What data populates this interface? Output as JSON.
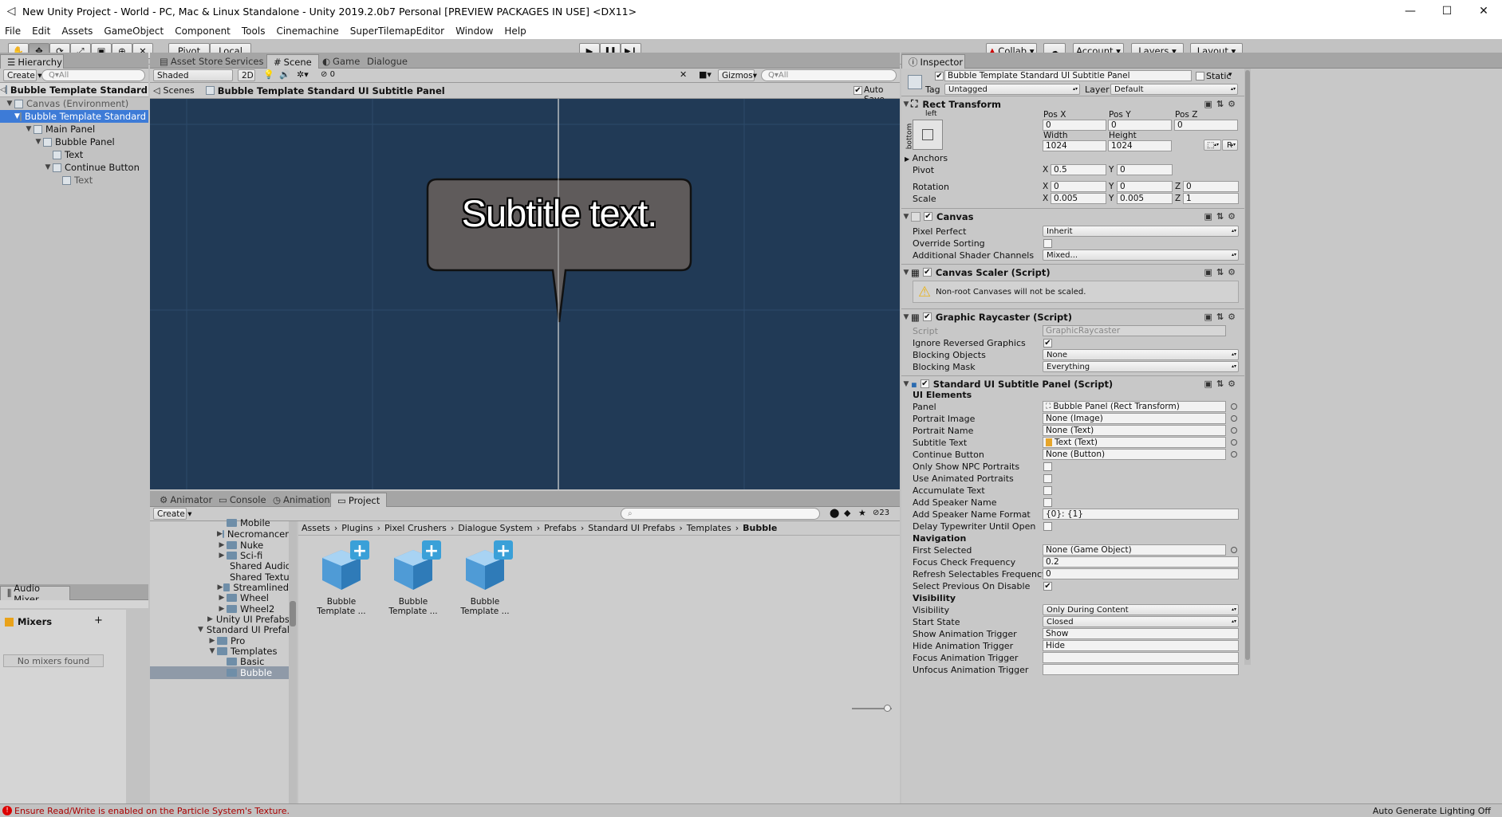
{
  "window": {
    "title": "New Unity Project - World - PC, Mac & Linux Standalone - Unity 2019.2.0b7 Personal [PREVIEW PACKAGES IN USE] <DX11>",
    "minimize": "—",
    "maximize": "☐",
    "close": "✕"
  },
  "menu": [
    "File",
    "Edit",
    "Assets",
    "GameObject",
    "Component",
    "Tools",
    "Cinemachine",
    "SuperTilemapEditor",
    "Window",
    "Help"
  ],
  "toolbar": {
    "pivot": "Pivot",
    "local": "Local",
    "collab": "Collab",
    "account": "Account",
    "layers": "Layers",
    "layout": "Layout",
    "play": "▶",
    "pause": "❚❚",
    "step": "▶❙"
  },
  "hierarchy": {
    "tab": "Hierarchy",
    "create": "Create",
    "search_placeholder": "Q▾All",
    "scene_title": "Bubble Template Standard UI",
    "items": [
      {
        "label": "Canvas (Environment)"
      },
      {
        "label": "Bubble Template Standard U"
      },
      {
        "label": "Main Panel"
      },
      {
        "label": "Bubble Panel"
      },
      {
        "label": "Text"
      },
      {
        "label": "Continue Button"
      },
      {
        "label": "Text"
      }
    ]
  },
  "audio_mixer": {
    "tab": "Audio Mixer",
    "mixers_label": "Mixers",
    "add": "+",
    "empty": "No mixers found"
  },
  "scene": {
    "tabs": [
      "Asset Store",
      "Services",
      "Scene",
      "Game",
      "Dialogue"
    ],
    "shading": "Shaded",
    "mode_2d": "2D",
    "fx_count": "0",
    "gizmos": "Gizmos",
    "search_placeholder": "Q▾All",
    "breadcrumb_root": "Scenes",
    "breadcrumb_item": "Bubble Template Standard UI Subtitle Panel",
    "auto_save": "Auto Save",
    "bubble_text": "Subtitle text.",
    "colors": {
      "bg": "#213a56",
      "bubble": "#5f5b5b"
    }
  },
  "project": {
    "tabs": [
      "Animator",
      "Console",
      "Animation",
      "Project"
    ],
    "create": "Create",
    "hidden_count": "23",
    "folders": [
      {
        "label": "Mobile"
      },
      {
        "label": "Necromancer"
      },
      {
        "label": "Nuke"
      },
      {
        "label": "Sci-fi"
      },
      {
        "label": "Shared Audio"
      },
      {
        "label": "Shared Textu"
      },
      {
        "label": "Streamlined"
      },
      {
        "label": "Wheel"
      },
      {
        "label": "Wheel2"
      },
      {
        "label": "Unity UI Prefabs"
      },
      {
        "label": "Standard UI Prefal"
      },
      {
        "label": "Pro"
      },
      {
        "label": "Templates"
      },
      {
        "label": "Basic"
      },
      {
        "label": "Bubble"
      }
    ],
    "breadcrumb": [
      "Assets",
      "Plugins",
      "Pixel Crushers",
      "Dialogue System",
      "Prefabs",
      "Standard UI Prefabs",
      "Templates",
      "Bubble"
    ],
    "assets": [
      {
        "label": "Bubble Template ..."
      },
      {
        "label": "Bubble Template ..."
      },
      {
        "label": "Bubble Template ..."
      }
    ]
  },
  "inspector": {
    "tab": "Inspector",
    "object_name": "Bubble Template Standard UI Subtitle Panel",
    "static": "Static",
    "tag_label": "Tag",
    "tag": "Untagged",
    "layer_label": "Layer",
    "layer": "Default",
    "rect": {
      "title": "Rect Transform",
      "anchor_h": "left",
      "anchor_v": "bottom",
      "posx_label": "Pos X",
      "posy_label": "Pos Y",
      "posz_label": "Pos Z",
      "posx": "0",
      "posy": "0",
      "posz": "0",
      "width_label": "Width",
      "height_label": "Height",
      "width": "1024",
      "height": "1024",
      "r_button": "R",
      "anchors": "Anchors",
      "pivot_label": "Pivot",
      "pivot_x": "0.5",
      "pivot_y": "0",
      "rotation_label": "Rotation",
      "rot_x": "0",
      "rot_y": "0",
      "rot_z": "0",
      "scale_label": "Scale",
      "scale_x": "0.005",
      "scale_y": "0.005",
      "scale_z": "1",
      "x": "X",
      "y": "Y",
      "z": "Z"
    },
    "canvas": {
      "title": "Canvas",
      "pixel_perfect_label": "Pixel Perfect",
      "pixel_perfect": "Inherit",
      "override_sorting_label": "Override Sorting",
      "shader_channels_label": "Additional Shader Channels",
      "shader_channels": "Mixed..."
    },
    "scaler": {
      "title": "Canvas Scaler (Script)",
      "warning": "Non-root Canvases will not be scaled."
    },
    "raycaster": {
      "title": "Graphic Raycaster (Script)",
      "script_label": "Script",
      "script": "GraphicRaycaster",
      "ignore_reversed_label": "Ignore Reversed Graphics",
      "blocking_objects_label": "Blocking Objects",
      "blocking_objects": "None",
      "blocking_mask_label": "Blocking Mask",
      "blocking_mask": "Everything"
    },
    "subtitle": {
      "title": "Standard UI Subtitle Panel (Script)",
      "ui_elements": "UI Elements",
      "panel_label": "Panel",
      "panel": "Bubble Panel (Rect Transform)",
      "portrait_image_label": "Portrait Image",
      "portrait_image": "None (Image)",
      "portrait_name_label": "Portrait Name",
      "portrait_name": "None (Text)",
      "subtitle_text_label": "Subtitle Text",
      "subtitle_text": "Text (Text)",
      "continue_button_label": "Continue Button",
      "continue_button": "None (Button)",
      "only_npc_label": "Only Show NPC Portraits",
      "animated_label": "Use Animated Portraits",
      "accumulate_label": "Accumulate Text",
      "add_speaker_label": "Add Speaker Name",
      "speaker_format_label": "Add Speaker Name Format",
      "speaker_format": "{0}: {1}",
      "delay_label": "Delay Typewriter Until Open",
      "navigation": "Navigation",
      "first_selected_label": "First Selected",
      "first_selected": "None (Game Object)",
      "focus_freq_label": "Focus Check Frequency",
      "focus_freq": "0.2",
      "refresh_label": "Refresh Selectables Frequency",
      "refresh": "0",
      "select_prev_label": "Select Previous On Disable",
      "visibility_section": "Visibility",
      "visibility_label": "Visibility",
      "visibility": "Only During Content",
      "start_state_label": "Start State",
      "start_state": "Closed",
      "show_anim_label": "Show Animation Trigger",
      "show_anim": "Show",
      "hide_anim_label": "Hide Animation Trigger",
      "hide_anim": "Hide",
      "focus_anim_label": "Focus Animation Trigger",
      "focus_anim": "",
      "unfocus_anim_label": "Unfocus Animation Trigger",
      "unfocus_anim": ""
    }
  },
  "status": {
    "message": "Ensure Read/Write is enabled on the Particle System's Texture.",
    "right": "Auto Generate Lighting Off"
  }
}
